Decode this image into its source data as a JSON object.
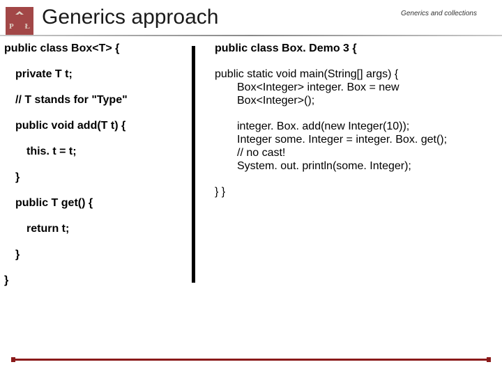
{
  "header": {
    "logo_left": "P",
    "logo_right": "Ł",
    "title": "Generics approach",
    "topic": "Generics and collections"
  },
  "left": {
    "l0": "public class Box<T> {",
    "l1": "private T t;",
    "l2": "// T stands for \"Type\"",
    "l3": "public void add(T t) {",
    "l4": "this. t = t;",
    "l5": "}",
    "l6": "public T get() {",
    "l7": "return t;",
    "l8": "}",
    "l9": "}"
  },
  "right": {
    "r0": "public class Box. Demo 3 {",
    "r1": "public static void main(String[] args) {",
    "r2": "Box<Integer> integer. Box = new",
    "r3": "Box<Integer>();",
    "r4": "integer. Box. add(new Integer(10));",
    "r5": "Integer some. Integer = integer. Box. get();",
    "r6": "// no cast!",
    "r7": "System. out. println(some. Integer);",
    "r8": "} }"
  }
}
